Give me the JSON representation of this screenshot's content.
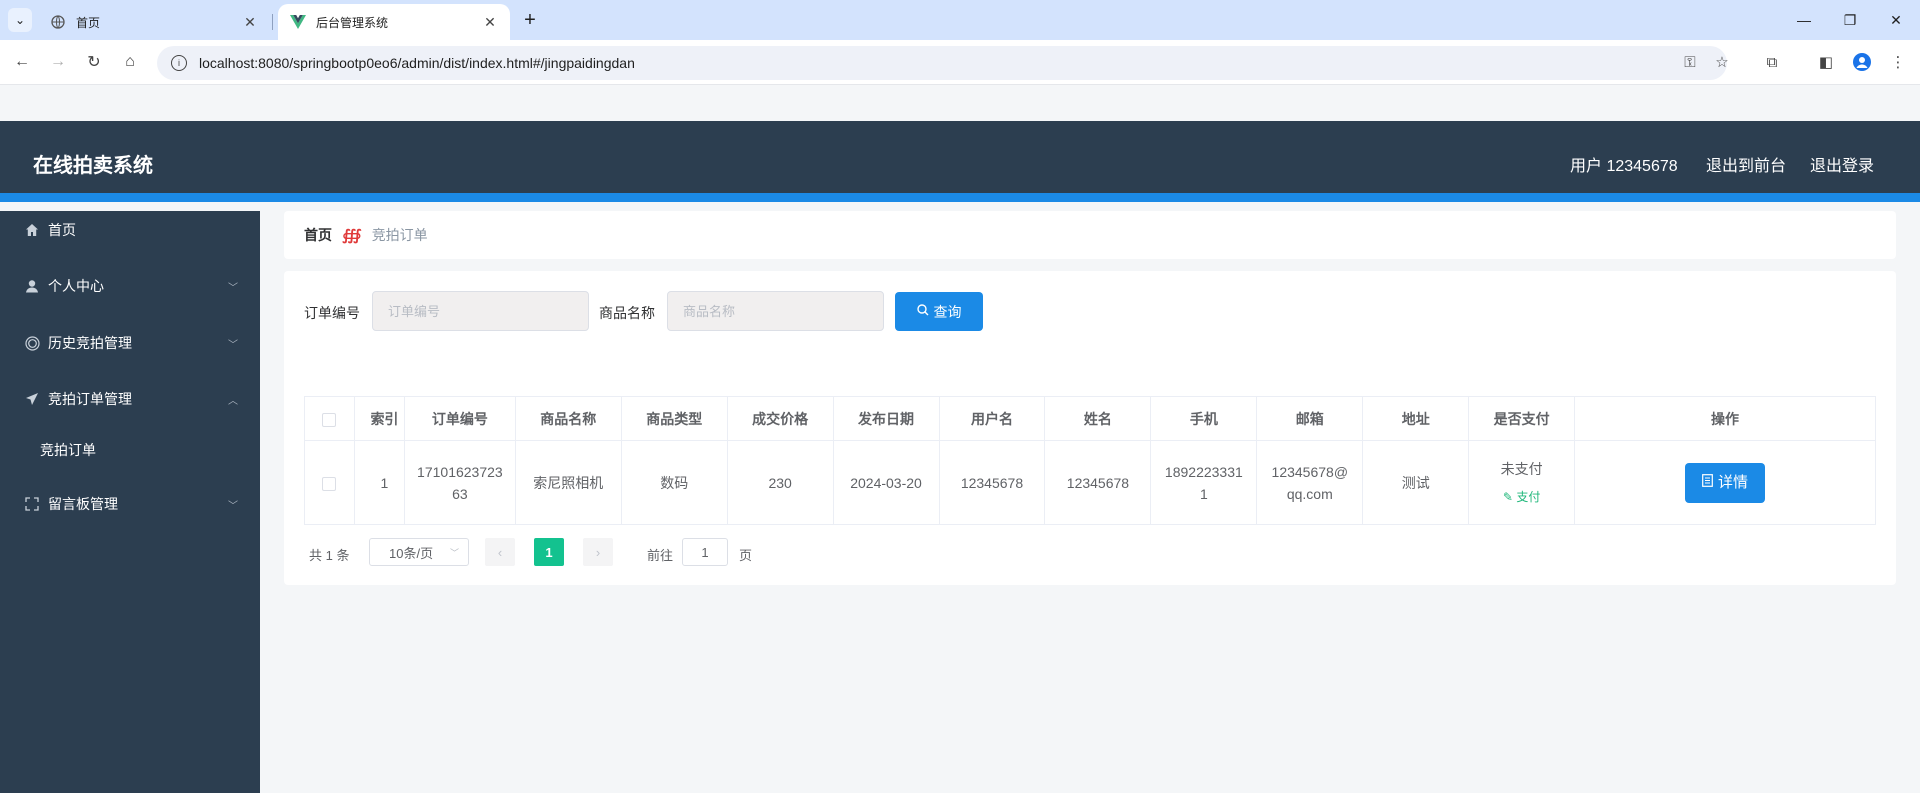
{
  "browser": {
    "tabs": [
      {
        "title": "首页",
        "active": false
      },
      {
        "title": "后台管理系统",
        "active": true
      }
    ],
    "url": "localhost:8080/springbootp0eo6/admin/dist/index.html#/jingpaidingdan"
  },
  "header": {
    "title": "在线拍卖系统",
    "user": "用户 12345678",
    "to_front": "退出到前台",
    "logout": "退出登录"
  },
  "sidebar": {
    "items": [
      {
        "label": "首页",
        "icon": "home-icon"
      },
      {
        "label": "个人中心",
        "icon": "user-icon"
      },
      {
        "label": "历史竞拍管理",
        "icon": "ring-icon"
      },
      {
        "label": "竞拍订单管理",
        "icon": "send-icon"
      },
      {
        "label": "竞拍订单",
        "icon": ""
      },
      {
        "label": "留言板管理",
        "icon": "fullscreen-icon"
      }
    ]
  },
  "breadcrumb": {
    "home": "首页",
    "separator": "∰",
    "current": "竞拍订单"
  },
  "search": {
    "order_no_label": "订单编号",
    "order_no_placeholder": "订单编号",
    "product_label": "商品名称",
    "product_placeholder": "商品名称",
    "query_label": "查询"
  },
  "table": {
    "headers": [
      "",
      "索引",
      "订单编号",
      "商品名称",
      "商品类型",
      "成交价格",
      "发布日期",
      "用户名",
      "姓名",
      "手机",
      "邮箱",
      "地址",
      "是否支付",
      "操作"
    ],
    "rows": [
      {
        "index": "1",
        "order_no": "1710162372363",
        "product_name": "索尼照相机",
        "product_type": "数码",
        "price": "230",
        "date": "2024-03-20",
        "username": "12345678",
        "name": "12345678",
        "phone": "18922233311",
        "email": "12345678@qq.com",
        "address": "测试",
        "paid": "未支付",
        "pay_action": "支付",
        "detail_label": "详情"
      }
    ]
  },
  "pagination": {
    "total": "共 1 条",
    "page_size": "10条/页",
    "current_page": "1",
    "goto_prefix": "前往",
    "goto_value": "1",
    "goto_suffix": "页"
  },
  "colors": {
    "header_bg": "#2c3e50",
    "accent": "#1b8ae6",
    "pager_active": "#13c28f"
  }
}
